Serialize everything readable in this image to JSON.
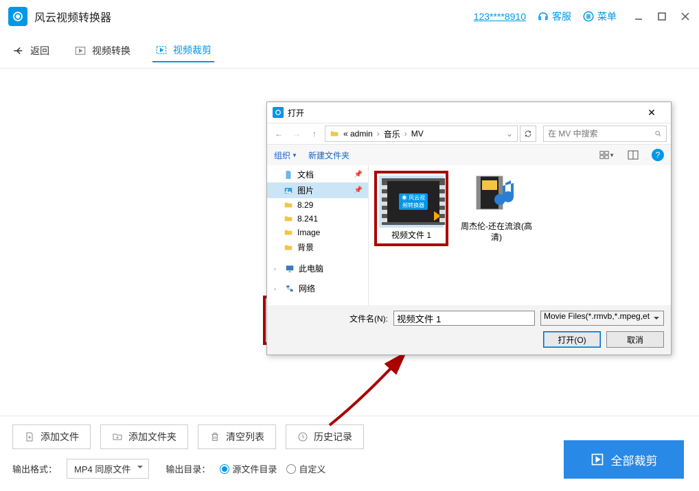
{
  "titlebar": {
    "app_name": "风云视频转换器",
    "phone": "123****8910",
    "support": "客服",
    "menu": "菜单"
  },
  "toolbar": {
    "back": "返回",
    "convert": "视频转换",
    "crop": "视频裁剪"
  },
  "add_file_btn": "添加文件",
  "bottom": {
    "add_file": "添加文件",
    "add_folder": "添加文件夹",
    "clear_list": "清空列表",
    "history": "历史记录",
    "out_format_label": "输出格式：",
    "out_format_value": "MP4 同原文件",
    "out_dir_label": "输出目录：",
    "radio_src": "源文件目录",
    "radio_custom": "自定义",
    "crop_all": "全部裁剪"
  },
  "dialog": {
    "title": "打开",
    "breadcrumb_prefix": "« admin",
    "breadcrumb_mid": "音乐",
    "breadcrumb_last": "MV",
    "search_placeholder": "在 MV 中搜索",
    "organize": "组织",
    "new_folder": "新建文件夹",
    "sidebar": [
      {
        "label": "文档",
        "icon": "doc",
        "pin": true
      },
      {
        "label": "图片",
        "icon": "img",
        "pin": true,
        "selected": true
      },
      {
        "label": "8.29",
        "icon": "folder"
      },
      {
        "label": "8.241",
        "icon": "folder"
      },
      {
        "label": "Image",
        "icon": "folder"
      },
      {
        "label": "背景",
        "icon": "folder"
      }
    ],
    "sidebar_pc": "此电脑",
    "sidebar_net": "网络",
    "files": [
      {
        "label": "视频文件 1",
        "type": "video",
        "selected": true
      },
      {
        "label": "周杰伦-还在流浪(高清)",
        "type": "audio"
      }
    ],
    "filename_label": "文件名(N):",
    "filename_value": "视频文件 1",
    "filter": "Movie Files(*.rmvb,*.mpeg,et",
    "open_btn": "打开(O)",
    "cancel_btn": "取消"
  }
}
